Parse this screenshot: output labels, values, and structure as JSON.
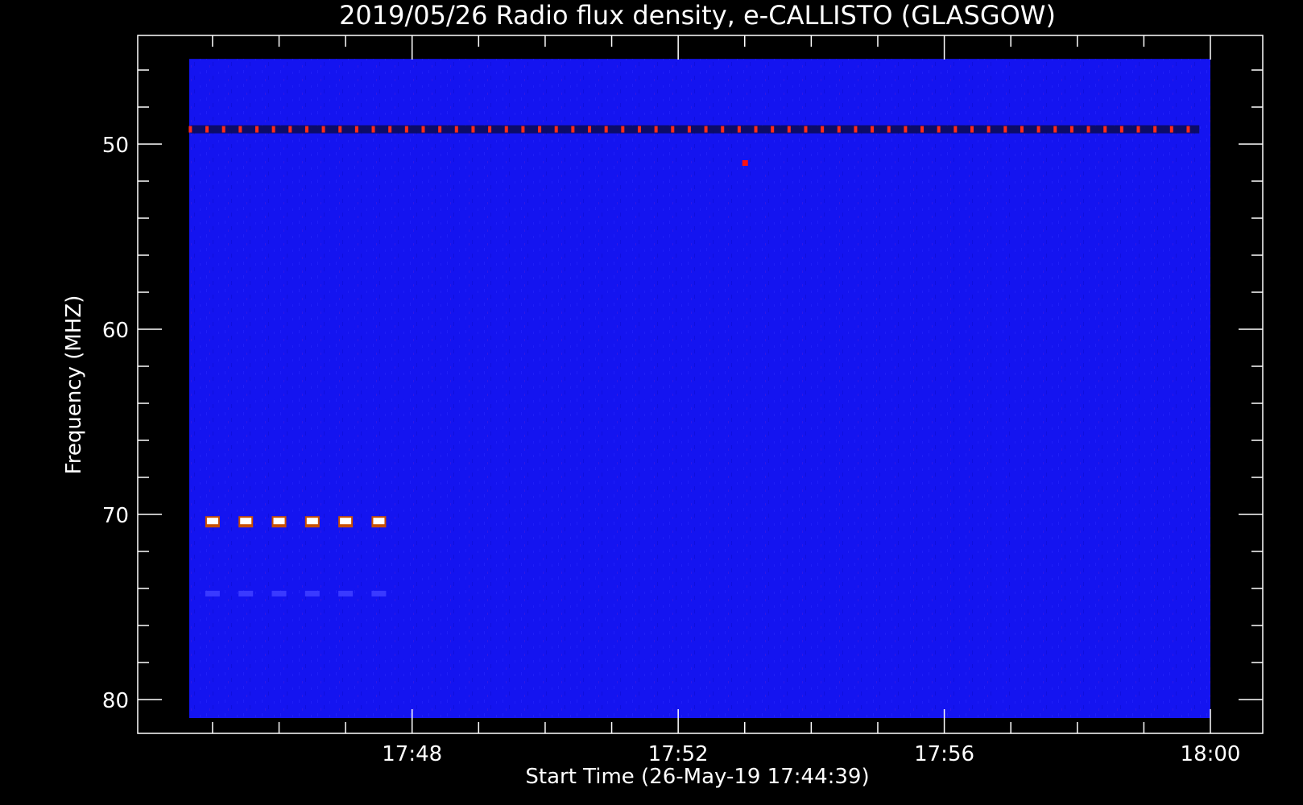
{
  "chart_data": {
    "type": "heatmap",
    "title": "2019/05/26  Radio flux density, e-CALLISTO (GLASGOW)",
    "xlabel": "Start Time (26-May-19 17:44:39)",
    "ylabel": "Frequency (MHZ)",
    "x_range": [
      "17:44:39",
      "18:00:00"
    ],
    "x_major_ticks": [
      {
        "label": "17:48",
        "minutes": 48
      },
      {
        "label": "17:52",
        "minutes": 52
      },
      {
        "label": "17:56",
        "minutes": 56
      },
      {
        "label": "18:00",
        "minutes": 60
      }
    ],
    "y_range": [
      44.5,
      81.9
    ],
    "y_inverted": true,
    "y_major_ticks": [
      {
        "label": "50",
        "value": 50
      },
      {
        "label": "60",
        "value": 60
      },
      {
        "label": "70",
        "value": 70
      },
      {
        "label": "80",
        "value": 80
      }
    ],
    "data_extent": {
      "time_start": "17:44:39",
      "time_end": "18:00:00",
      "freq_min": 45.4,
      "freq_max": 81.0
    },
    "background_color": "#1414f0",
    "features": [
      {
        "kind": "periodic-interference-band",
        "freq": 49.2,
        "time_start": "17:44:40",
        "time_end": "17:59:50",
        "period_seconds": 15,
        "color": "#ff2a1a"
      },
      {
        "kind": "isolated-spike",
        "freq": 51.0,
        "time": "17:53:00",
        "color": "#ff1010"
      },
      {
        "kind": "bright-pulse-series",
        "freq": 70.4,
        "times": [
          "17:45:00",
          "17:45:30",
          "17:46:00",
          "17:46:30",
          "17:47:00",
          "17:47:30"
        ],
        "color": "#ffffff"
      },
      {
        "kind": "faint-pulse-series",
        "freq": 74.3,
        "times": [
          "17:45:00",
          "17:45:30",
          "17:46:00",
          "17:46:30",
          "17:47:00",
          "17:47:30"
        ],
        "color": "#3a3aff"
      }
    ]
  }
}
